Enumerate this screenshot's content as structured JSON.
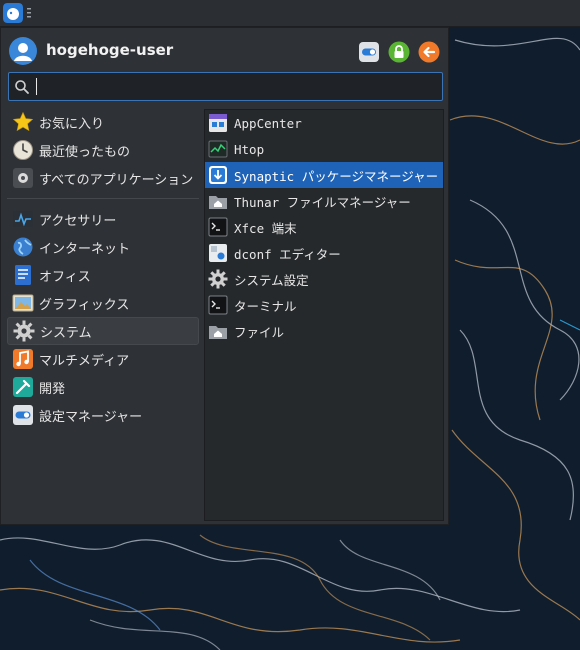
{
  "user": {
    "name": "hogehoge-user"
  },
  "search": {
    "value": "",
    "placeholder": ""
  },
  "categories": [
    {
      "label": "お気に入り",
      "icon": "star-icon"
    },
    {
      "label": "最近使ったもの",
      "icon": "clock-icon"
    },
    {
      "label": "すべてのアプリケーション",
      "icon": "gear-icon"
    },
    {
      "label": "アクセサリー",
      "icon": "accessories-icon"
    },
    {
      "label": "インターネット",
      "icon": "globe-icon"
    },
    {
      "label": "オフィス",
      "icon": "document-icon"
    },
    {
      "label": "グラフィックス",
      "icon": "picture-icon"
    },
    {
      "label": "システム",
      "icon": "gear-icon",
      "selected": true
    },
    {
      "label": "マルチメディア",
      "icon": "music-icon"
    },
    {
      "label": "開発",
      "icon": "hammer-icon"
    },
    {
      "label": "設定マネージャー",
      "icon": "toggle-icon"
    }
  ],
  "apps": [
    {
      "label": "AppCenter",
      "icon": "store-icon"
    },
    {
      "label": "Htop",
      "icon": "monitor-graph-icon"
    },
    {
      "label": "Synaptic パッケージマネージャー",
      "icon": "package-download-icon",
      "selected": true
    },
    {
      "label": "Thunar ファイルマネージャー",
      "icon": "home-folder-icon"
    },
    {
      "label": "Xfce 端末",
      "icon": "terminal-icon"
    },
    {
      "label": "dconf エディター",
      "icon": "dconf-icon"
    },
    {
      "label": "システム設定",
      "icon": "settings-gear-icon"
    },
    {
      "label": "ターミナル",
      "icon": "terminal-icon"
    },
    {
      "label": "ファイル",
      "icon": "home-folder-icon"
    }
  ],
  "colors": {
    "accent": "#1f63b8",
    "search_border": "#3a74b6",
    "menu_bg": "#2e3135"
  }
}
